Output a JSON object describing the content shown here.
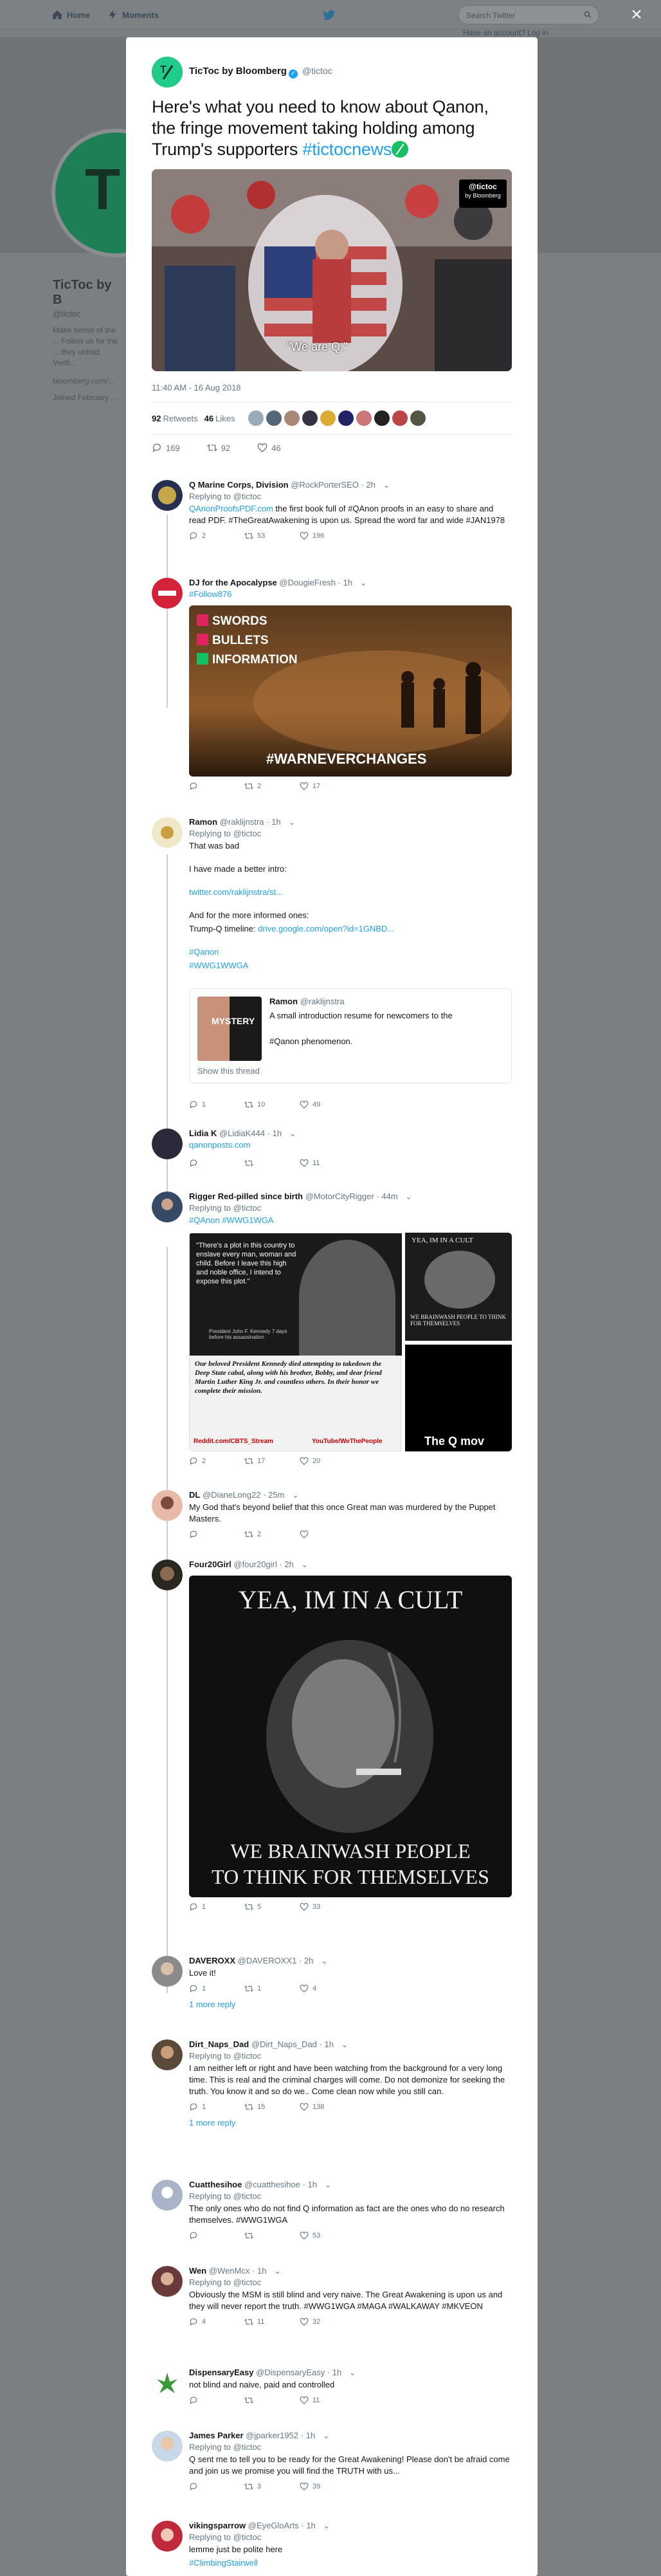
{
  "topbar": {
    "home": "Home",
    "moments": "Moments",
    "search_placeholder": "Search Twitter",
    "have_account": "Have an account? Log in"
  },
  "background_profile": {
    "name": "TicToc by B",
    "handle": "@tictoc",
    "bio": "Make sense of the ... Follow us for the ... they unfold. Verifi...",
    "site": "bloomberg.com/...",
    "joined": "Joined February ..."
  },
  "main_tweet": {
    "author_name": "TicToc by Bloomberg",
    "author_handle": "@tictoc",
    "text": "Here's what you need to know about Qanon, the fringe movement taking holding among Trump's supporters ",
    "hashtag": "#tictocnews",
    "media_caption": "\"We are Q.\"",
    "badge_handle": "@tictoc",
    "badge_brand": "by Bloomberg",
    "timestamp": "11:40 AM - 16 Aug 2018",
    "retweets_count": "92",
    "retweets_label": "Retweets",
    "likes_count": "46",
    "likes_label": "Likes",
    "action_reply": "169",
    "action_retweet": "92",
    "action_like": "46"
  },
  "replies": [
    {
      "name": "Q Marine Corps, Division",
      "handle": "@RockPorterSEO",
      "time": "2h",
      "replying": "Replying to @tictoc",
      "text_link": "QAnonProofsPDF.com",
      "text": " the first book full of #QAnon proofs in an easy to share and read PDF. #TheGreatAwakening is upon us.  Spread the word far and wide #JAN1978",
      "reply": "2",
      "retweet": "53",
      "like": "196"
    },
    {
      "name": "DJ for the Apocalypse",
      "handle": "@DougieFresh",
      "time": "1h",
      "replying": "#Follow876",
      "image_lines": [
        "SWORDS",
        "BULLETS",
        "INFORMATION"
      ],
      "image_tag": "#WARNEVERCHANGES",
      "reply": "",
      "retweet": "2",
      "like": "17"
    },
    {
      "name": "Ramon",
      "handle": "@raklijnstra",
      "time": "1h",
      "replying": "Replying to @tictoc",
      "text": "That was bad",
      "text2": "I have made a better intro:",
      "link1": "twitter.com/raklijnstra/st...",
      "text3": "And for the more informed ones:",
      "text4": "Trump-Q timeline: ",
      "link2": "drive.google.com/open?id=1GNBD...",
      "tags": "#Qanon",
      "tags2": "#WWG1WWGA",
      "quote_name": "Ramon",
      "quote_handle": "@raklijnstra",
      "quote_text": "A small introduction resume for newcomers to the",
      "quote_text2": "#Qanon phenomenon.",
      "quote_thumb": "MYSTERY",
      "show_thread": "Show this thread",
      "reply": "1",
      "retweet": "10",
      "like": "49"
    },
    {
      "name": "Lidia K",
      "handle": "@LidiaK444",
      "time": "1h",
      "replying": "qanonposts.com",
      "reply": "",
      "retweet": "",
      "like": "11"
    },
    {
      "name": "Rigger Red-pilled since birth",
      "handle": "@MotorCityRigger",
      "time": "44m",
      "replying": "Replying to @tictoc",
      "text": "#QAnon #WWG1WGA",
      "quote_text": "\"There's a plot in this country to enslave every man, woman and child. Before I leave this high and noble office, I intend to expose this plot.\"",
      "quote_attr": "President John F. Kennedy 7 days before his assassination",
      "caption": "Our beloved President Kennedy died attempting to takedown the Deep State cabal, along with his brother, Bobby, and dear friend Martin Luther King Jr. and countless others. In their honor we complete their mission.",
      "src1": "Reddit.com/CBTS_Stream",
      "src2": "YouTube/WeThePeople",
      "side_title": "YEA, IM IN A CULT",
      "side_sub": "WE BRAINWASH PEOPLE TO THINK FOR THEMSELVES",
      "side_bottom": "The Q mov",
      "reply": "2",
      "retweet": "17",
      "like": "20"
    },
    {
      "name": "DL",
      "handle": "@DianeLong22",
      "time": "25m",
      "text": "My God that's beyond belief that this once Great man was murdered by the Puppet Masters.",
      "reply": "",
      "retweet": "2",
      "like": ""
    },
    {
      "name": "Four20Girl",
      "handle": "@four20girl",
      "time": "2h",
      "image_title": "YEA, IM IN A CULT",
      "image_sub1": "WE BRAINWASH PEOPLE",
      "image_sub2": "TO THINK FOR THEMSELVES",
      "reply": "1",
      "retweet": "5",
      "like": "33"
    },
    {
      "name": "DAVEROXX",
      "handle": "@DAVEROXX1",
      "time": "2h",
      "text": "Love it!",
      "reply": "1",
      "retweet": "1",
      "like": "4",
      "more": "1 more reply"
    },
    {
      "name": "Dirt_Naps_Dad",
      "handle": "@Dirt_Naps_Dad",
      "time": "1h",
      "replying": "Replying to @tictoc",
      "text": "I am neither left or right and have been watching from the background for a very long time.  This is real and the criminal charges will come.  Do not demonize for seeking the truth.  You know it and so do we.. Come clean now while you still can.",
      "reply": "1",
      "retweet": "15",
      "like": "138",
      "more": "1 more reply"
    },
    {
      "name": "Cuatthesihoe",
      "handle": "@cuatthesihoe",
      "time": "1h",
      "replying": "Replying to @tictoc",
      "text": "The only ones who do not find Q information as fact are the ones who do no research themselves. #WWG1WGA",
      "reply": "",
      "retweet": "",
      "like": "53"
    },
    {
      "name": "Wen",
      "handle": "@WenMcx",
      "time": "1h",
      "replying": "Replying to @tictoc",
      "text": "Obviously the MSM is still blind and very naive. The Great Awakening is upon us and they will never report the truth. #WWG1WGA #MAGA #WALKAWAY #MKVEON",
      "reply": "4",
      "retweet": "11",
      "like": "32"
    },
    {
      "name": "DispensaryEasy",
      "handle": "@DispensaryEasy",
      "time": "1h",
      "text": "not blind and naive, paid and controlled",
      "reply": "",
      "retweet": "",
      "like": "11"
    },
    {
      "name": "James Parker",
      "handle": "@jparker1952",
      "time": "1h",
      "replying": "Replying to @tictoc",
      "text": "Q sent me to tell you to be ready for the Great Awakening! Please don't be afraid come and join us we promise you will find the TRUTH with us...",
      "reply": "",
      "retweet": "3",
      "like": "39"
    },
    {
      "name": "vikingsparrow",
      "handle": "@EyeGloArts",
      "time": "1h",
      "replying": "Replying to @tictoc",
      "text": "lemme just be polite here",
      "text2": "#ClimbingStairwell"
    }
  ]
}
